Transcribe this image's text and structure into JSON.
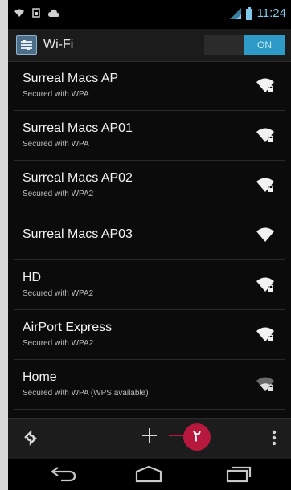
{
  "status_bar": {
    "time": "11:24",
    "left_icons": [
      "wifi-icon",
      "sim-icon",
      "cloud-icon"
    ],
    "right_icons": [
      "signal-icon",
      "battery-icon"
    ]
  },
  "action_bar": {
    "icon": "settings-icon",
    "title": "Wi-Fi",
    "toggle_label": "ON"
  },
  "networks": [
    {
      "name": "Surreal Macs AP",
      "security": "Secured with WPA",
      "signal": "strong"
    },
    {
      "name": "Surreal Macs AP01",
      "security": "Secured with WPA",
      "signal": "strong"
    },
    {
      "name": "Surreal Macs AP02",
      "security": "Secured with WPA2",
      "signal": "strong"
    },
    {
      "name": "Surreal Macs AP03",
      "security": "",
      "signal": "strong"
    },
    {
      "name": "HD",
      "security": "Secured with WPA2",
      "signal": "strong"
    },
    {
      "name": "AirPort Express",
      "security": "Secured with WPA2",
      "signal": "strong"
    },
    {
      "name": "Home",
      "security": "Secured with WPA (WPS available)",
      "signal": "weak"
    }
  ],
  "bottom_bar": {
    "icons": [
      "scan-icon",
      "add-icon",
      "overflow-menu-icon"
    ],
    "badge_label": "٢"
  },
  "nav_bar": {
    "icons": [
      "back-icon",
      "home-icon",
      "recent-apps-icon"
    ]
  },
  "colors": {
    "accent": "#2d9ac7",
    "callout": "#b6183e",
    "time": "#7ec8ea"
  }
}
